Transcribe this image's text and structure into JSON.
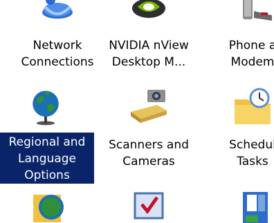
{
  "items": [
    {
      "id": "network",
      "label_lines": [
        "Network",
        "Connections"
      ],
      "icon": "network-connections-icon"
    },
    {
      "id": "nvidia",
      "label_lines": [
        "NVIDIA nView",
        "Desktop M..."
      ],
      "icon": "nvidia-nview-icon"
    },
    {
      "id": "phone",
      "label_lines": [
        "Phone a",
        "Modem"
      ],
      "icon": "phone-modem-icon"
    },
    {
      "id": "regional",
      "label_lines": [
        "Regional and",
        "Language",
        "Options"
      ],
      "icon": "globe-icon",
      "selected": true
    },
    {
      "id": "scanners",
      "label_lines": [
        "Scanners and",
        "Cameras"
      ],
      "icon": "scanner-camera-icon"
    },
    {
      "id": "scheduled",
      "label_lines": [
        "Schedul",
        "Tasks"
      ],
      "icon": "scheduled-tasks-folder-icon"
    },
    {
      "id": "row3a",
      "label_lines": [],
      "icon": "globe-window-icon"
    },
    {
      "id": "row3b",
      "label_lines": [],
      "icon": "security-center-icon"
    },
    {
      "id": "row3c",
      "label_lines": [],
      "icon": "taskbar-start-menu-icon"
    }
  ],
  "colors": {
    "selection_bg": "#0a246a",
    "selection_text": "#ffffff",
    "text": "#000000",
    "background": "#ffffff"
  }
}
